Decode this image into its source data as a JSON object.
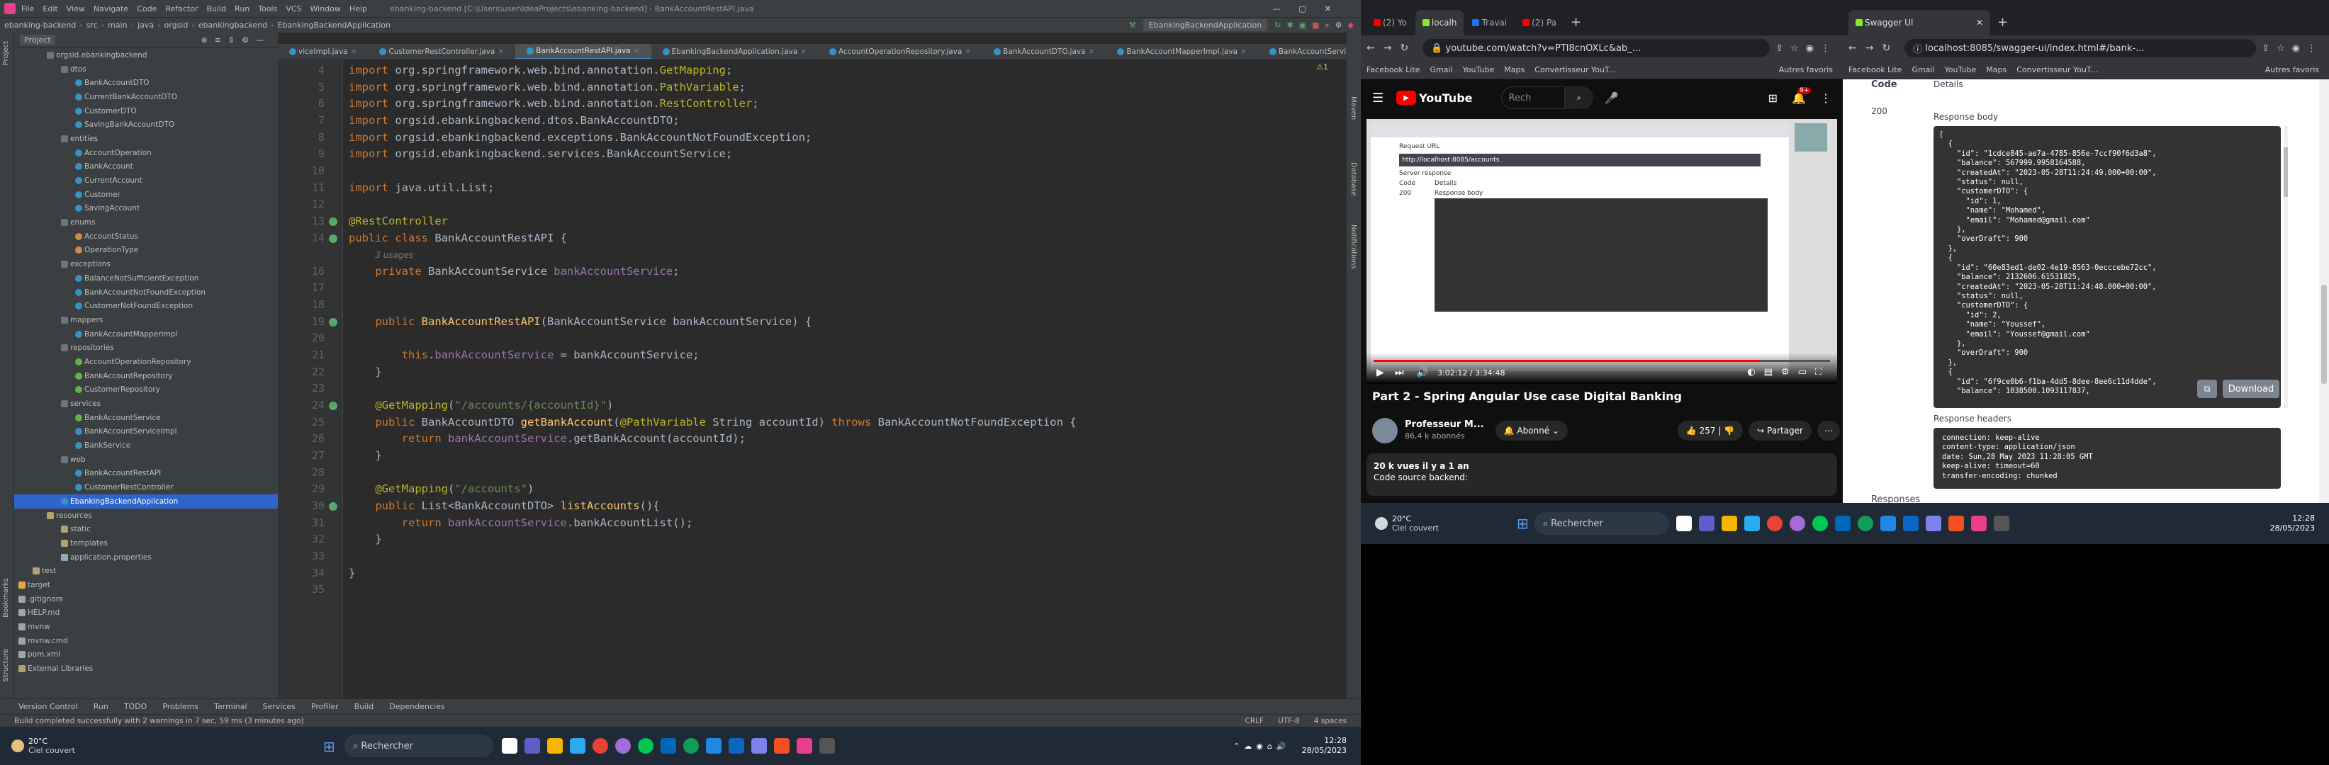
{
  "ide": {
    "menu": [
      "File",
      "Edit",
      "View",
      "Navigate",
      "Code",
      "Refactor",
      "Build",
      "Run",
      "Tools",
      "VCS",
      "Window",
      "Help"
    ],
    "window_title": "ebanking-backend [C:\\Users\\user\\IdeaProjects\\ebanking-backend] - BankAccountRestAPI.java",
    "breadcrumb": [
      "ebanking-backend",
      "src",
      "main",
      "java",
      "orgsid",
      "ebankingbackend",
      "EbankingBackendApplication"
    ],
    "run_config": "EbankingBackendApplication",
    "project_label": "Project",
    "tree": [
      {
        "label": "orgsid.ebankingbackend",
        "indent": 2,
        "type": "pkg"
      },
      {
        "label": "dtos",
        "indent": 3,
        "type": "pkg"
      },
      {
        "label": "BankAccountDTO",
        "indent": 4,
        "type": "class"
      },
      {
        "label": "CurrentBankAccountDTO",
        "indent": 4,
        "type": "class"
      },
      {
        "label": "CustomerDTO",
        "indent": 4,
        "type": "class"
      },
      {
        "label": "SavingBankAccountDTO",
        "indent": 4,
        "type": "class"
      },
      {
        "label": "entities",
        "indent": 3,
        "type": "pkg"
      },
      {
        "label": "AccountOperation",
        "indent": 4,
        "type": "class"
      },
      {
        "label": "BankAccount",
        "indent": 4,
        "type": "class"
      },
      {
        "label": "CurrentAccount",
        "indent": 4,
        "type": "class"
      },
      {
        "label": "Customer",
        "indent": 4,
        "type": "class"
      },
      {
        "label": "SavingAccount",
        "indent": 4,
        "type": "class"
      },
      {
        "label": "enums",
        "indent": 3,
        "type": "pkg"
      },
      {
        "label": "AccountStatus",
        "indent": 4,
        "type": "enum"
      },
      {
        "label": "OperationType",
        "indent": 4,
        "type": "enum"
      },
      {
        "label": "exceptions",
        "indent": 3,
        "type": "pkg"
      },
      {
        "label": "BalanceNotSufficientException",
        "indent": 4,
        "type": "class"
      },
      {
        "label": "BankAccountNotFoundException",
        "indent": 4,
        "type": "class"
      },
      {
        "label": "CustomerNotFoundException",
        "indent": 4,
        "type": "class"
      },
      {
        "label": "mappers",
        "indent": 3,
        "type": "pkg"
      },
      {
        "label": "BankAccountMapperImpl",
        "indent": 4,
        "type": "class"
      },
      {
        "label": "repositories",
        "indent": 3,
        "type": "pkg"
      },
      {
        "label": "AccountOperationRepository",
        "indent": 4,
        "type": "iface"
      },
      {
        "label": "BankAccountRepository",
        "indent": 4,
        "type": "iface"
      },
      {
        "label": "CustomerRepository",
        "indent": 4,
        "type": "iface"
      },
      {
        "label": "services",
        "indent": 3,
        "type": "pkg"
      },
      {
        "label": "BankAccountService",
        "indent": 4,
        "type": "iface"
      },
      {
        "label": "BankAccountServiceImpl",
        "indent": 4,
        "type": "class"
      },
      {
        "label": "BankService",
        "indent": 4,
        "type": "class"
      },
      {
        "label": "web",
        "indent": 3,
        "type": "pkg"
      },
      {
        "label": "BankAccountRestAPI",
        "indent": 4,
        "type": "class"
      },
      {
        "label": "CustomerRestController",
        "indent": 4,
        "type": "class"
      },
      {
        "label": "EbankingBackendApplication",
        "indent": 3,
        "type": "class",
        "selected": true
      },
      {
        "label": "resources",
        "indent": 2,
        "type": "folder"
      },
      {
        "label": "static",
        "indent": 3,
        "type": "folder"
      },
      {
        "label": "templates",
        "indent": 3,
        "type": "folder"
      },
      {
        "label": "application.properties",
        "indent": 3,
        "type": "file"
      },
      {
        "label": "test",
        "indent": 1,
        "type": "folder"
      },
      {
        "label": "target",
        "indent": 0,
        "type": "target"
      },
      {
        "label": ".gitignore",
        "indent": 0,
        "type": "file"
      },
      {
        "label": "HELP.md",
        "indent": 0,
        "type": "file"
      },
      {
        "label": "mvnw",
        "indent": 0,
        "type": "file"
      },
      {
        "label": "mvnw.cmd",
        "indent": 0,
        "type": "file"
      },
      {
        "label": "pom.xml",
        "indent": 0,
        "type": "file"
      },
      {
        "label": "External Libraries",
        "indent": 0,
        "type": "lib"
      }
    ],
    "tabs": [
      {
        "label": "viceImpl.java",
        "active": false
      },
      {
        "label": "CustomerRestController.java",
        "active": false
      },
      {
        "label": "BankAccountRestAPI.java",
        "active": true
      },
      {
        "label": "EbankingBackendApplication.java",
        "active": false
      },
      {
        "label": "AccountOperationRepository.java",
        "active": false
      },
      {
        "label": "BankAccountDTO.java",
        "active": false
      },
      {
        "label": "BankAccountMapperImpl.java",
        "active": false
      },
      {
        "label": "BankAccountServi",
        "active": false
      }
    ],
    "warnings": "1",
    "code": [
      {
        "n": "4",
        "html": "<span class='kw'>import</span> org.springframework.web.bind.annotation.<span class='an'>GetMapping</span>;"
      },
      {
        "n": "5",
        "html": "<span class='kw'>import</span> org.springframework.web.bind.annotation.<span class='an'>PathVariable</span>;"
      },
      {
        "n": "6",
        "html": "<span class='kw'>import</span> org.springframework.web.bind.annotation.<span class='an'>RestController</span>;"
      },
      {
        "n": "7",
        "html": "<span class='kw'>import</span> orgsid.ebankingbackend.dtos.BankAccountDTO;"
      },
      {
        "n": "8",
        "html": "<span class='kw'>import</span> orgsid.ebankingbackend.exceptions.BankAccountNotFoundException;"
      },
      {
        "n": "9",
        "html": "<span class='kw'>import</span> orgsid.ebankingbackend.services.BankAccountService;"
      },
      {
        "n": "10",
        "html": ""
      },
      {
        "n": "11",
        "html": "<span class='kw'>import</span> java.util.List;"
      },
      {
        "n": "12",
        "html": ""
      },
      {
        "n": "13",
        "html": "<span class='an'>@RestController</span>"
      },
      {
        "n": "14",
        "html": "<span class='kw'>public class</span> BankAccountRestAPI {"
      },
      {
        "n": "",
        "html": "    <span class='hint'>3 usages</span>"
      },
      {
        "n": "16",
        "html": "    <span class='kw'>private</span> BankAccountService <span class='fd'>bankAccountService</span>;"
      },
      {
        "n": "17",
        "html": ""
      },
      {
        "n": "18",
        "html": ""
      },
      {
        "n": "19",
        "html": "    <span class='kw'>public</span> <span class='fn'>BankAccountRestAPI</span>(BankAccountService bankAccountService) {"
      },
      {
        "n": "20",
        "html": ""
      },
      {
        "n": "21",
        "html": "        <span class='kw'>this</span>.<span class='fd'>bankAccountService</span> = bankAccountService;"
      },
      {
        "n": "22",
        "html": "    }"
      },
      {
        "n": "23",
        "html": ""
      },
      {
        "n": "24",
        "html": "    <span class='an'>@GetMapping</span>(<span class='st'>\"/accounts/{accountId}\"</span>)"
      },
      {
        "n": "25",
        "html": "    <span class='kw'>public</span> BankAccountDTO <span class='fn'>getBankAccount</span>(<span class='an'>@PathVariable</span> String accountId) <span class='kw'>throws</span> BankAccountNotFoundException {"
      },
      {
        "n": "26",
        "html": "        <span class='kw'>return</span> <span class='fd'>bankAccountService</span>.getBankAccount(accountId);"
      },
      {
        "n": "27",
        "html": "    }"
      },
      {
        "n": "28",
        "html": ""
      },
      {
        "n": "29",
        "html": "    <span class='an'>@GetMapping</span>(<span class='st'>\"/accounts\"</span>)"
      },
      {
        "n": "30",
        "html": "    <span class='kw'>public</span> List&lt;BankAccountDTO&gt; <span class='fn'>listAccounts</span>(){"
      },
      {
        "n": "31",
        "html": "        <span class='kw'>return</span> <span class='fd'>bankAccountService</span>.bankAccountList();"
      },
      {
        "n": "32",
        "html": "    }"
      },
      {
        "n": "33",
        "html": ""
      },
      {
        "n": "34",
        "html": "}"
      },
      {
        "n": "35",
        "html": ""
      }
    ],
    "bottom_tools": [
      "Version Control",
      "Run",
      "TODO",
      "Problems",
      "Terminal",
      "Services",
      "Profiler",
      "Build",
      "Dependencies"
    ],
    "status_text": "Build completed successfully with 2 warnings in 7 sec, 59 ms (3 minutes ago)",
    "status_right": [
      "CRLF",
      "UTF-8",
      "4 spaces"
    ]
  },
  "taskbar": {
    "weather_temp": "20°C",
    "weather_desc": "Ciel couvert",
    "search": "Rechercher",
    "time": "12:28",
    "date": "28/05/2023"
  },
  "youtube": {
    "tabs": [
      "(2) Yo",
      "localh",
      "Travai",
      "(2) Pa"
    ],
    "url": "youtube.com/watch?v=PTI8cnOXLc&ab_...",
    "bookmarks": [
      "Facebook Lite",
      "Gmail",
      "YouTube",
      "Maps",
      "Convertisseur YouT...",
      "Autres favoris"
    ],
    "search_placeholder": "Rech",
    "notif_count": "9+",
    "time": "3:02:12 / 3:34:48",
    "title": "Part 2 - Spring Angular Use case Digital Banking",
    "channel": "Professeur M...",
    "subs": "86,4 k abonnés",
    "subscribed": "Abonné",
    "likes": "257",
    "share": "Partager",
    "views": "20 k vues  il y a 1 an",
    "desc": "Code source backend:",
    "video_lines": [
      "Request URL",
      "http://localhost:8085/accounts",
      "Server response",
      "Code",
      "Details",
      "200",
      "Response body"
    ]
  },
  "swagger": {
    "tab": "Swagger UI",
    "url": "localhost:8085/swagger-ui/index.html#/bank-...",
    "bookmarks": [
      "Facebook Lite",
      "Gmail",
      "YouTube",
      "Maps",
      "Convertisseur YouT...",
      "Autres favoris"
    ],
    "code_label": "Code",
    "details_label": "Details",
    "status_code": "200",
    "response_body_label": "Response body",
    "body": [
      "[",
      "  {",
      "    \"id\": \"1cdce845-ae7a-4785-856e-7ccf90f6d3a8\",",
      "    \"balance\": 567999.9958164588,",
      "    \"createdAt\": \"2023-05-28T11:24:49.000+00:00\",",
      "    \"status\": null,",
      "    \"customerDTO\": {",
      "      \"id\": 1,",
      "      \"name\": \"Mohamed\",",
      "      \"email\": \"Mohamed@gmail.com\"",
      "    },",
      "    \"overDraft\": 900",
      "  },",
      "  {",
      "    \"id\": \"60e83ed1-de02-4e19-8563-0ecccebe72cc\",",
      "    \"balance\": 2132606.61531825,",
      "    \"createdAt\": \"2023-05-28T11:24:48.000+00:00\",",
      "    \"status\": null,",
      "    \"customerDTO\": {",
      "      \"id\": 2,",
      "      \"name\": \"Youssef\",",
      "      \"email\": \"Youssef@gmail.com\"",
      "    },",
      "    \"overDraft\": 900",
      "  },",
      "  {",
      "    \"id\": \"6f9ce0b6-f1ba-4dd5-8dee-8ee6c11d4dde\",",
      "    \"balance\": 1038500.1093117837,"
    ],
    "download": "Download",
    "response_headers_label": "Response headers",
    "headers": [
      "connection: keep-alive",
      "content-type: application/json",
      "date: Sun,28 May 2023 11:28:05 GMT",
      "keep-alive: timeout=60",
      "transfer-encoding: chunked"
    ],
    "responses_label": "Responses"
  }
}
